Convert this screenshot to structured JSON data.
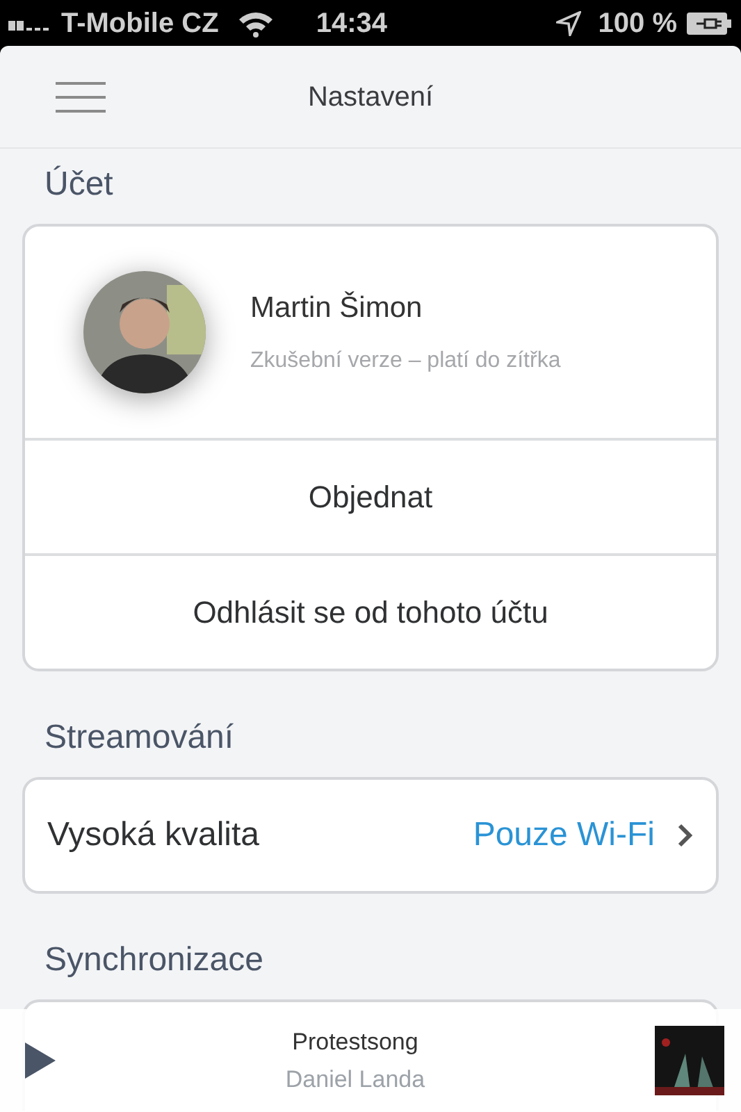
{
  "status_bar": {
    "carrier": "T-Mobile CZ",
    "time": "14:34",
    "battery": "100 %"
  },
  "header": {
    "title": "Nastavení"
  },
  "account": {
    "title": "Účet",
    "name": "Martin Šimon",
    "subtitle": "Zkušební verze – platí do zítřka",
    "actions": [
      "Objednat",
      "Odhlásit se od tohoto účtu"
    ]
  },
  "streaming": {
    "title": "Streamování",
    "rows": [
      {
        "label": "Vysoká kvalita",
        "value": "Pouze Wi-Fi"
      }
    ]
  },
  "sync": {
    "title": "Synchronizace"
  },
  "player": {
    "track": "Protestsong",
    "artist": "Daniel Landa"
  }
}
